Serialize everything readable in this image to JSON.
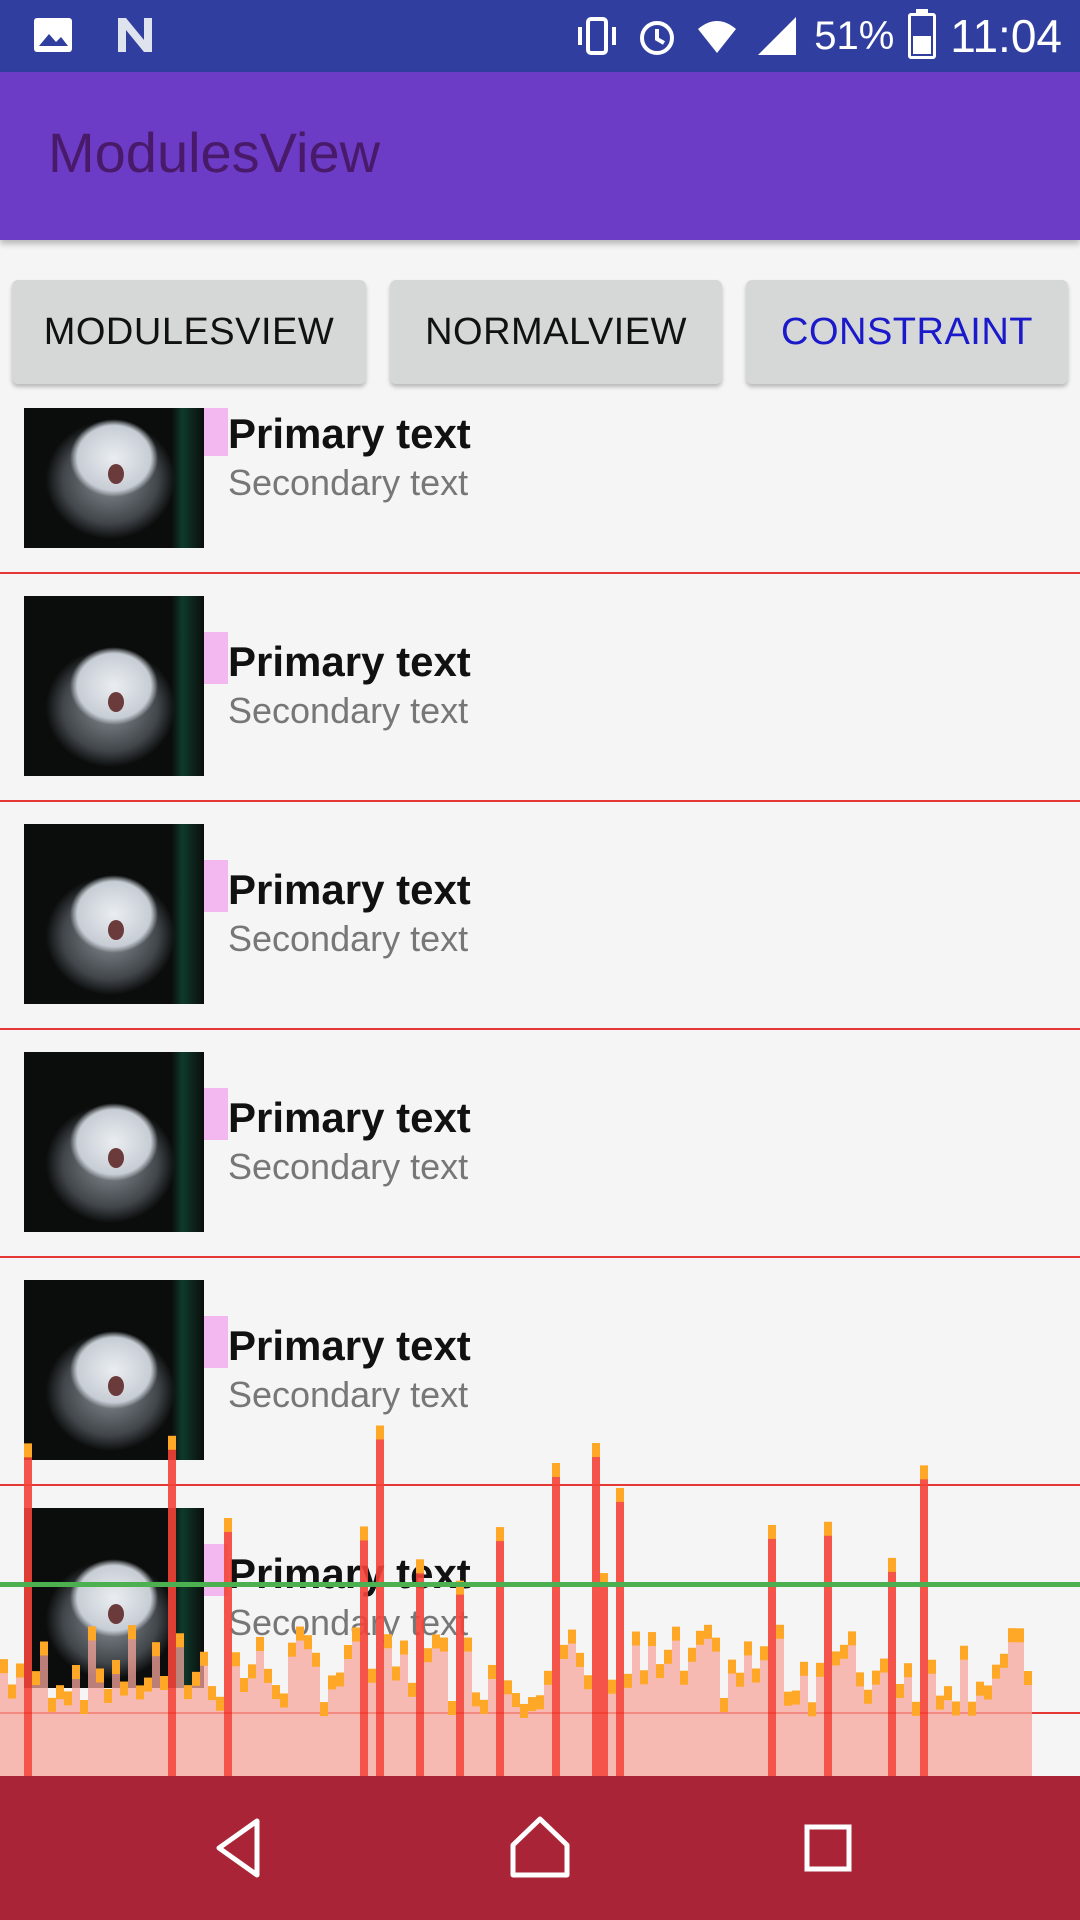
{
  "status_bar": {
    "battery_percent": "51%",
    "time": "11:04",
    "icons": [
      "image-icon",
      "n-icon",
      "vibrate-icon",
      "alarm-icon",
      "wifi-icon",
      "signal-icon",
      "battery-charging-icon"
    ]
  },
  "app_bar": {
    "title": "ModulesView"
  },
  "buttons": {
    "modulesview": "MODULESVIEW",
    "normalview": "NORMALVIEW",
    "constraint": "CONSTRAINT"
  },
  "list": {
    "items": [
      {
        "primary": "Primary text",
        "secondary": "Secondary text"
      },
      {
        "primary": "Primary text",
        "secondary": "Secondary text"
      },
      {
        "primary": "Primary text",
        "secondary": "Secondary text"
      },
      {
        "primary": "Primary text",
        "secondary": "Secondary text"
      },
      {
        "primary": "Primary text",
        "secondary": "Secondary text"
      },
      {
        "primary": "Primary text",
        "secondary": "Secondary text"
      }
    ]
  },
  "nav_bar": {
    "icons": [
      "back-icon",
      "home-icon",
      "recent-apps-icon"
    ]
  },
  "colors": {
    "status_bar": "#303f9f",
    "app_bar": "#6c3cc6",
    "accent_button_text": "#1a1acb",
    "profiler_red": "#f44336",
    "profiler_orange": "#ffa726",
    "profiler_green_line": "#4caf50"
  }
}
